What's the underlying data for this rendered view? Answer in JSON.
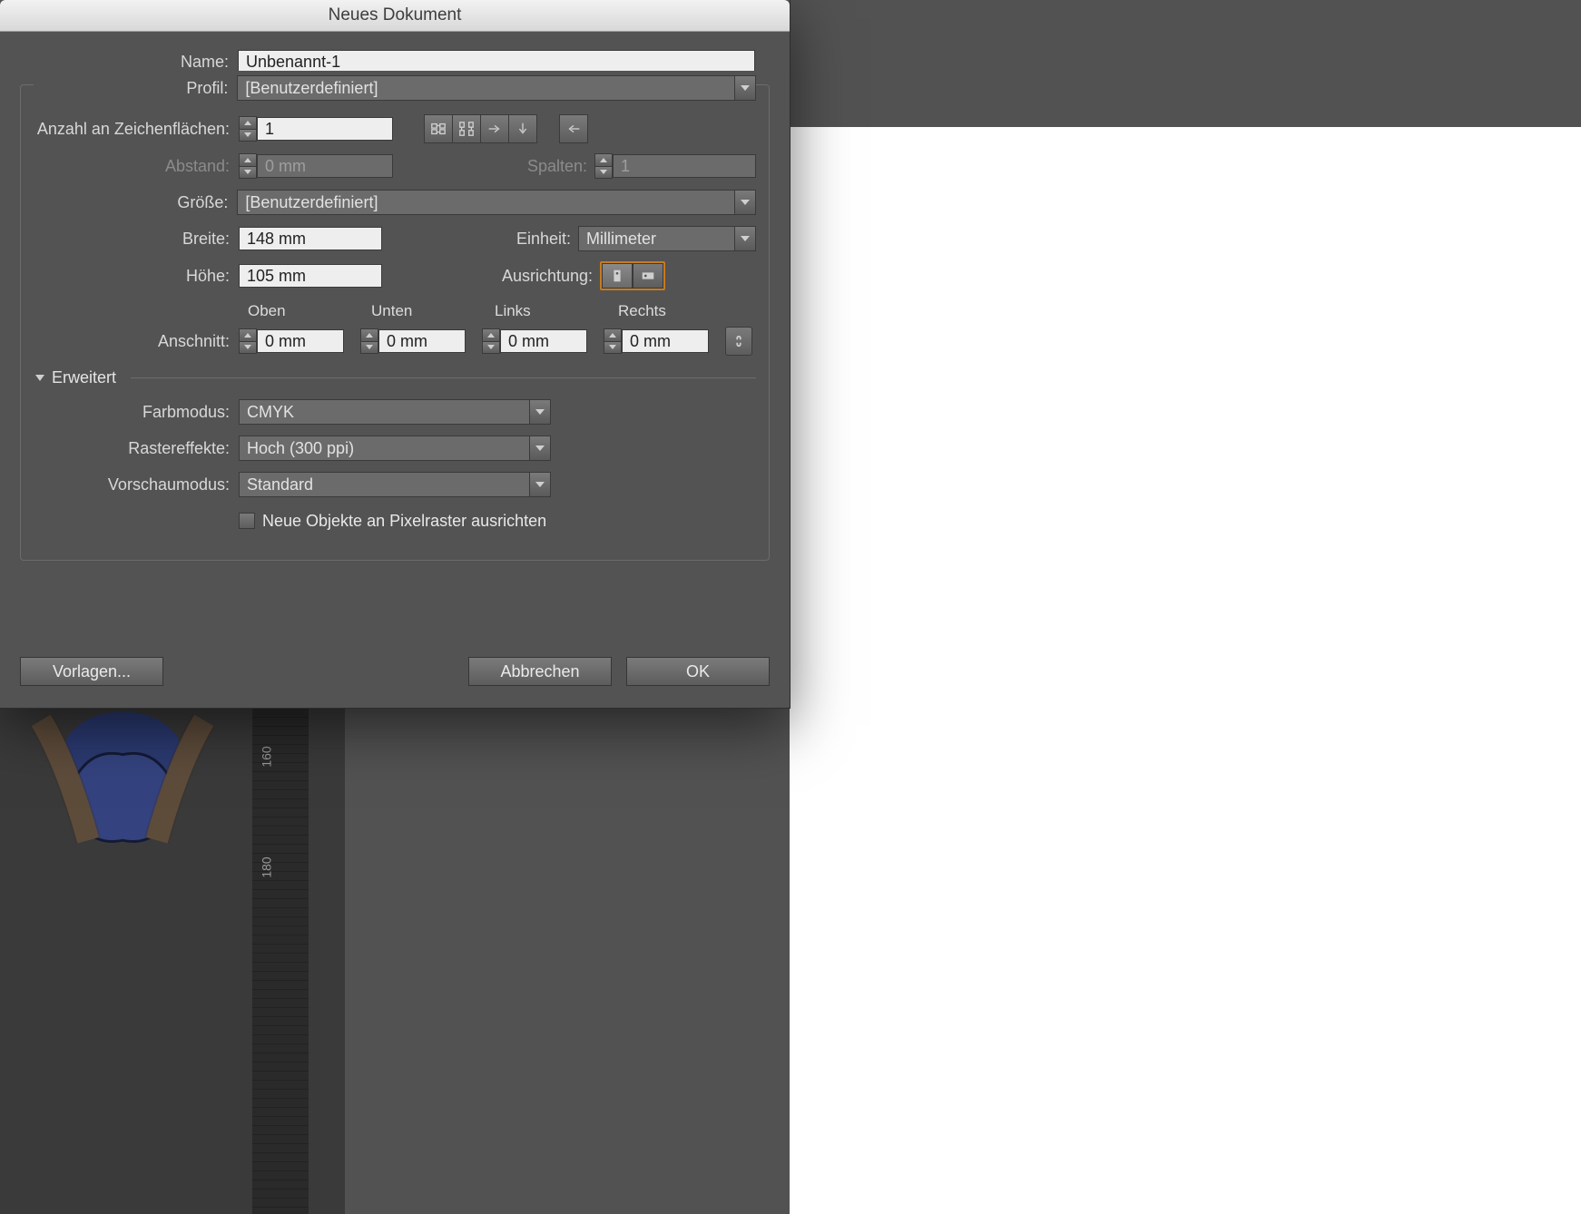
{
  "dialog": {
    "title": "Neues Dokument",
    "name_label": "Name:",
    "name_value": "Unbenannt-1",
    "profile_label": "Profil:",
    "profile_value": "[Benutzerdefiniert]",
    "artboards_label": "Anzahl an Zeichenflächen:",
    "artboards_value": "1",
    "spacing_label": "Abstand:",
    "spacing_value": "0 mm",
    "columns_label": "Spalten:",
    "columns_value": "1",
    "size_label": "Größe:",
    "size_value": "[Benutzerdefiniert]",
    "width_label": "Breite:",
    "width_value": "148 mm",
    "units_label": "Einheit:",
    "units_value": "Millimeter",
    "height_label": "Höhe:",
    "height_value": "105 mm",
    "orientation_label": "Ausrichtung:",
    "bleed_label": "Anschnitt:",
    "bleed_top_label": "Oben",
    "bleed_bottom_label": "Unten",
    "bleed_left_label": "Links",
    "bleed_right_label": "Rechts",
    "bleed_top": "0 mm",
    "bleed_bottom": "0 mm",
    "bleed_left": "0 mm",
    "bleed_right": "0 mm",
    "advanced_label": "Erweitert",
    "colormode_label": "Farbmodus:",
    "colormode_value": "CMYK",
    "raster_label": "Rastereffekte:",
    "raster_value": "Hoch (300 ppi)",
    "preview_label": "Vorschaumodus:",
    "preview_value": "Standard",
    "pixel_align_label": "Neue Objekte an Pixelraster ausrichten",
    "templates_button": "Vorlagen...",
    "cancel_button": "Abbrechen",
    "ok_button": "OK"
  },
  "ruler": {
    "ticks": [
      "160",
      "180"
    ]
  },
  "colors": {
    "accent": "#c97a1e",
    "panel": "#535353",
    "input_light": "#eeeeee",
    "input_dark": "#6b6b6b"
  }
}
